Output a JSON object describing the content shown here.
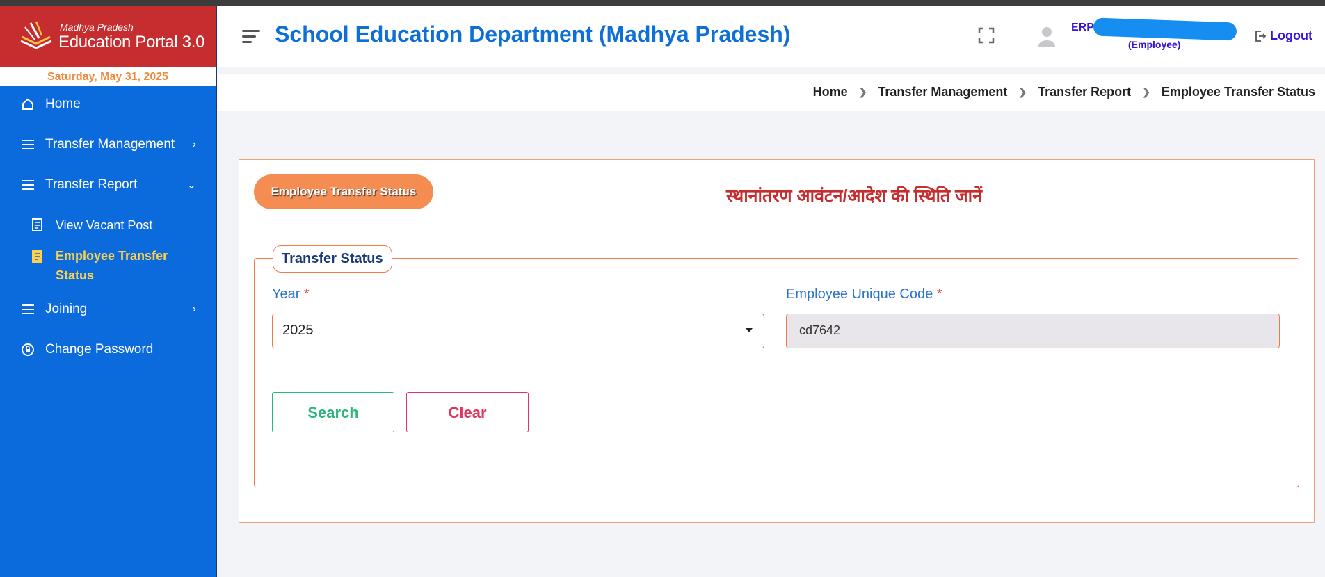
{
  "brand": {
    "small": "Madhya Pradesh",
    "title": "Education Portal 3.0",
    "date": "Saturday, May 31, 2025"
  },
  "sidebar": {
    "items": [
      {
        "label": "Home",
        "icon": "home-icon"
      },
      {
        "label": "Transfer Management",
        "icon": "list-icon"
      },
      {
        "label": "Transfer Report",
        "icon": "list-icon"
      },
      {
        "label": "View Vacant Post",
        "icon": "report-icon"
      },
      {
        "label": "Employee Transfer Status",
        "icon": "report-icon"
      },
      {
        "label": "Joining",
        "icon": "list-icon"
      },
      {
        "label": "Change Password",
        "icon": "lock-icon"
      }
    ]
  },
  "header": {
    "title": "School Education Department (Madhya Pradesh)",
    "user_prefix": "ERP -",
    "user_role": "(Employee)",
    "logout": "Logout"
  },
  "breadcrumb": [
    "Home",
    "Transfer Management",
    "Transfer Report",
    "Employee Transfer Status"
  ],
  "card": {
    "pill": "Employee Transfer Status",
    "hindi_title": "स्थानांतरण आवंटन/आदेश की स्थिति जानें",
    "legend": "Transfer Status",
    "year_label": "Year",
    "year_value": "2025",
    "code_label": "Employee Unique Code",
    "code_value": "cd7642",
    "required_mark": "*",
    "search_btn": "Search",
    "clear_btn": "Clear"
  },
  "colors": {
    "sidebar": "#0b6bdc",
    "brand": "#c62d2f",
    "accent_orange": "#f27a46",
    "title_blue": "#0e6fd6",
    "active_nav": "#ffd24a"
  }
}
